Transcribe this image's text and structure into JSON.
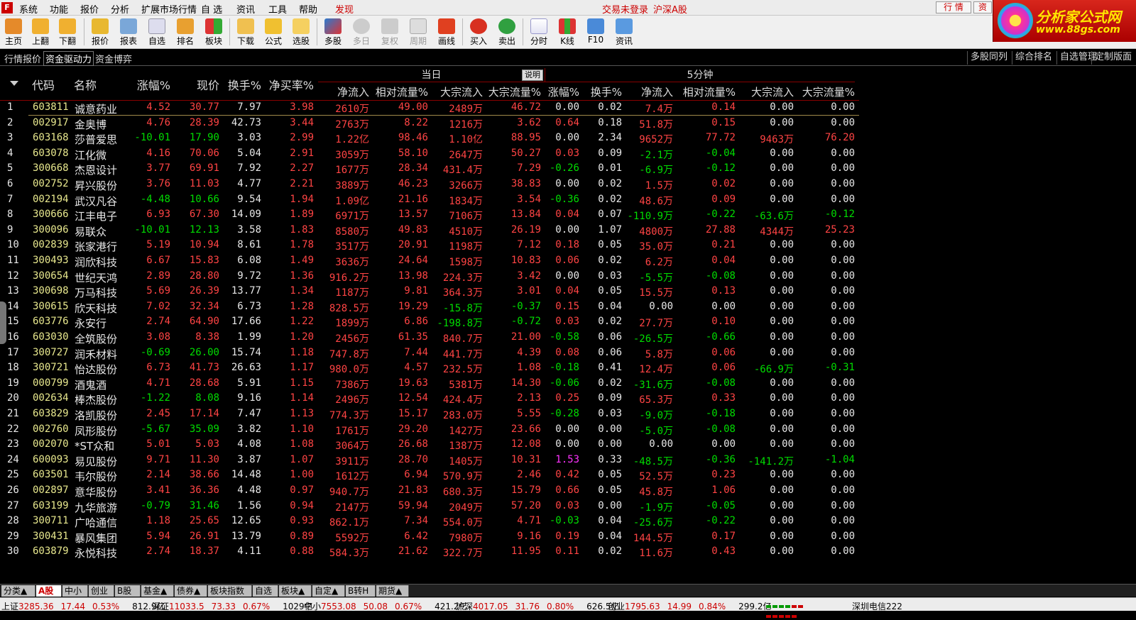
{
  "menu": {
    "items": [
      "系统",
      "功能",
      "报价",
      "分析",
      "扩展市场行情",
      "自 选",
      "资讯",
      "工具",
      "帮助",
      "发现"
    ],
    "trade_notice": "交易未登录",
    "market_notice": "沪深A股",
    "right_buttons": [
      "行 情",
      "资"
    ]
  },
  "brand": {
    "title": "分析家公式网",
    "url": "www.88gs.com"
  },
  "toolbar": {
    "buttons": [
      "主页",
      "上翻",
      "下翻",
      "报价",
      "报表",
      "自选",
      "排名",
      "板块",
      "下载",
      "公式",
      "选股",
      "多股",
      "多日",
      "复权",
      "周期",
      "画线",
      "买入",
      "卖出",
      "分时",
      "K线",
      "F10",
      "资讯"
    ]
  },
  "tabs": {
    "left": [
      "行情报价",
      "资金驱动力",
      "资金博弈"
    ],
    "right": [
      "多股同列",
      "综合排名",
      "自选管理",
      "定制版面"
    ]
  },
  "table": {
    "group_today": "当日",
    "group_today_btn": "说明",
    "group_5min": "5分钟",
    "headers": [
      "代码",
      "名称",
      "涨幅%",
      "现价",
      "换手%",
      "净买率%",
      "净流入",
      "相对流量%",
      "大宗流入",
      "大宗流量%",
      "涨幅%",
      "换手%",
      "净流入",
      "相对流量%",
      "大宗流入",
      "大宗流量%"
    ],
    "rows": [
      [
        "1",
        "603811",
        "诚意药业",
        "4.52",
        "30.77",
        "7.97",
        "3.98",
        "2610万",
        "49.00",
        "2489万",
        "46.72",
        "0.00",
        "0.02",
        "7.4万",
        "0.14",
        "0.00",
        "0.00"
      ],
      [
        "2",
        "002917",
        "金奥博",
        "4.76",
        "28.39",
        "42.73",
        "3.44",
        "2763万",
        "8.22",
        "1216万",
        "3.62",
        "0.64",
        "0.18",
        "51.8万",
        "0.15",
        "0.00",
        "0.00"
      ],
      [
        "3",
        "603168",
        "莎普爱思",
        "-10.01",
        "17.90",
        "3.03",
        "2.99",
        "1.22亿",
        "98.46",
        "1.10亿",
        "88.95",
        "0.00",
        "2.34",
        "9652万",
        "77.72",
        "9463万",
        "76.20"
      ],
      [
        "4",
        "603078",
        "江化微",
        "4.16",
        "70.06",
        "5.04",
        "2.91",
        "3059万",
        "58.10",
        "2647万",
        "50.27",
        "0.03",
        "0.09",
        "-2.1万",
        "-0.04",
        "0.00",
        "0.00"
      ],
      [
        "5",
        "300668",
        "杰恩设计",
        "3.77",
        "69.91",
        "7.92",
        "2.27",
        "1677万",
        "28.34",
        "431.4万",
        "7.29",
        "-0.26",
        "0.01",
        "-6.9万",
        "-0.12",
        "0.00",
        "0.00"
      ],
      [
        "6",
        "002752",
        "昇兴股份",
        "3.76",
        "11.03",
        "4.77",
        "2.21",
        "3889万",
        "46.23",
        "3266万",
        "38.83",
        "0.00",
        "0.02",
        "1.5万",
        "0.02",
        "0.00",
        "0.00"
      ],
      [
        "7",
        "002194",
        "武汉凡谷",
        "-4.48",
        "10.66",
        "9.54",
        "1.94",
        "1.09亿",
        "21.16",
        "1834万",
        "3.54",
        "-0.36",
        "0.02",
        "48.6万",
        "0.09",
        "0.00",
        "0.00"
      ],
      [
        "8",
        "300666",
        "江丰电子",
        "6.93",
        "67.30",
        "14.09",
        "1.89",
        "6971万",
        "13.57",
        "7106万",
        "13.84",
        "0.04",
        "0.07",
        "-110.9万",
        "-0.22",
        "-63.6万",
        "-0.12"
      ],
      [
        "9",
        "300096",
        "易联众",
        "-10.01",
        "12.13",
        "3.58",
        "1.83",
        "8580万",
        "49.83",
        "4510万",
        "26.19",
        "0.00",
        "1.07",
        "4800万",
        "27.88",
        "4344万",
        "25.23"
      ],
      [
        "10",
        "002839",
        "张家港行",
        "5.19",
        "10.94",
        "8.61",
        "1.78",
        "3517万",
        "20.91",
        "1198万",
        "7.12",
        "0.18",
        "0.05",
        "35.0万",
        "0.21",
        "0.00",
        "0.00"
      ],
      [
        "11",
        "300493",
        "润欣科技",
        "6.67",
        "15.83",
        "6.08",
        "1.49",
        "3636万",
        "24.64",
        "1598万",
        "10.83",
        "0.06",
        "0.02",
        "6.2万",
        "0.04",
        "0.00",
        "0.00"
      ],
      [
        "12",
        "300654",
        "世纪天鸿",
        "2.89",
        "28.80",
        "9.72",
        "1.36",
        "916.2万",
        "13.98",
        "224.3万",
        "3.42",
        "0.00",
        "0.03",
        "-5.5万",
        "-0.08",
        "0.00",
        "0.00"
      ],
      [
        "13",
        "300698",
        "万马科技",
        "5.69",
        "26.39",
        "13.77",
        "1.34",
        "1187万",
        "9.81",
        "364.3万",
        "3.01",
        "0.04",
        "0.05",
        "15.5万",
        "0.13",
        "0.00",
        "0.00"
      ],
      [
        "14",
        "300615",
        "欣天科技",
        "7.02",
        "32.34",
        "6.73",
        "1.28",
        "828.5万",
        "19.29",
        "-15.8万",
        "-0.37",
        "0.15",
        "0.04",
        "0.00",
        "0.00",
        "0.00",
        "0.00"
      ],
      [
        "15",
        "603776",
        "永安行",
        "2.74",
        "64.90",
        "17.66",
        "1.22",
        "1899万",
        "6.86",
        "-198.8万",
        "-0.72",
        "0.03",
        "0.02",
        "27.7万",
        "0.10",
        "0.00",
        "0.00"
      ],
      [
        "16",
        "603030",
        "全筑股份",
        "3.08",
        "8.38",
        "1.99",
        "1.20",
        "2456万",
        "61.35",
        "840.7万",
        "21.00",
        "-0.58",
        "0.06",
        "-26.5万",
        "-0.66",
        "0.00",
        "0.00"
      ],
      [
        "17",
        "300727",
        "润禾材料",
        "-0.69",
        "26.00",
        "15.74",
        "1.18",
        "747.8万",
        "7.44",
        "441.7万",
        "4.39",
        "0.08",
        "0.06",
        "5.8万",
        "0.06",
        "0.00",
        "0.00"
      ],
      [
        "18",
        "300721",
        "怡达股份",
        "6.73",
        "41.73",
        "26.63",
        "1.17",
        "980.0万",
        "4.57",
        "232.5万",
        "1.08",
        "-0.18",
        "0.41",
        "12.4万",
        "0.06",
        "-66.9万",
        "-0.31"
      ],
      [
        "19",
        "000799",
        "酒鬼酒",
        "4.71",
        "28.68",
        "5.91",
        "1.15",
        "7386万",
        "19.63",
        "5381万",
        "14.30",
        "-0.06",
        "0.02",
        "-31.6万",
        "-0.08",
        "0.00",
        "0.00"
      ],
      [
        "20",
        "002634",
        "棒杰股份",
        "-1.22",
        "8.08",
        "9.16",
        "1.14",
        "2496万",
        "12.54",
        "424.4万",
        "2.13",
        "0.25",
        "0.09",
        "65.3万",
        "0.33",
        "0.00",
        "0.00"
      ],
      [
        "21",
        "603829",
        "洛凯股份",
        "2.45",
        "17.14",
        "7.47",
        "1.13",
        "774.3万",
        "15.17",
        "283.0万",
        "5.55",
        "-0.28",
        "0.03",
        "-9.0万",
        "-0.18",
        "0.00",
        "0.00"
      ],
      [
        "22",
        "002760",
        "凤形股份",
        "-5.67",
        "35.09",
        "3.82",
        "1.10",
        "1761万",
        "29.20",
        "1427万",
        "23.66",
        "0.00",
        "0.00",
        "-5.0万",
        "-0.08",
        "0.00",
        "0.00"
      ],
      [
        "23",
        "002070",
        "*ST众和",
        "5.01",
        "5.03",
        "4.08",
        "1.08",
        "3064万",
        "26.68",
        "1387万",
        "12.08",
        "0.00",
        "0.00",
        "0.00",
        "0.00",
        "0.00",
        "0.00"
      ],
      [
        "24",
        "600093",
        "易见股份",
        "9.71",
        "11.30",
        "3.87",
        "1.07",
        "3911万",
        "28.70",
        "1405万",
        "10.31",
        "1.53",
        "0.33",
        "-48.5万",
        "-0.36",
        "-141.2万",
        "-1.04"
      ],
      [
        "25",
        "603501",
        "韦尔股份",
        "2.14",
        "38.66",
        "14.48",
        "1.00",
        "1612万",
        "6.94",
        "570.9万",
        "2.46",
        "0.42",
        "0.05",
        "52.5万",
        "0.23",
        "0.00",
        "0.00"
      ],
      [
        "26",
        "002897",
        "意华股份",
        "3.41",
        "36.36",
        "4.48",
        "0.97",
        "940.7万",
        "21.83",
        "680.3万",
        "15.79",
        "0.66",
        "0.05",
        "45.8万",
        "1.06",
        "0.00",
        "0.00"
      ],
      [
        "27",
        "603199",
        "九华旅游",
        "-0.79",
        "31.46",
        "1.56",
        "0.94",
        "2147万",
        "59.94",
        "2049万",
        "57.20",
        "0.03",
        "0.00",
        "-1.9万",
        "-0.05",
        "0.00",
        "0.00"
      ],
      [
        "28",
        "300711",
        "广哈通信",
        "1.18",
        "25.65",
        "12.65",
        "0.93",
        "862.1万",
        "7.34",
        "554.0万",
        "4.71",
        "-0.03",
        "0.04",
        "-25.6万",
        "-0.22",
        "0.00",
        "0.00"
      ],
      [
        "29",
        "300431",
        "暴风集团",
        "5.94",
        "26.91",
        "13.79",
        "0.89",
        "5592万",
        "6.42",
        "7980万",
        "9.16",
        "0.19",
        "0.04",
        "144.5万",
        "0.17",
        "0.00",
        "0.00"
      ],
      [
        "30",
        "603879",
        "永悦科技",
        "2.74",
        "18.37",
        "4.11",
        "0.88",
        "584.3万",
        "21.62",
        "322.7万",
        "11.95",
        "0.11",
        "0.02",
        "11.6万",
        "0.43",
        "0.00",
        "0.00"
      ]
    ]
  },
  "bottom_tabs": [
    "分类▲",
    "A股",
    "中小",
    "创业",
    "B股",
    "基金▲",
    "债券▲",
    "板块指数",
    "自选",
    "板块▲",
    "自定▲",
    "B转H",
    "期货▲"
  ],
  "status": [
    {
      "name": "上证",
      "price": "3285.36",
      "chg": "17.44",
      "pct": "0.53%",
      "amt": "812.9亿"
    },
    {
      "name": "深证",
      "price": "11033.5",
      "chg": "73.33",
      "pct": "0.67%",
      "amt": "1029亿"
    },
    {
      "name": "中小",
      "price": "7553.08",
      "chg": "50.08",
      "pct": "0.67%",
      "amt": "421.2亿"
    },
    {
      "name": "沪深",
      "price": "4017.05",
      "chg": "31.76",
      "pct": "0.80%",
      "amt": "626.5亿"
    },
    {
      "name": "创业",
      "price": "1795.63",
      "chg": "14.99",
      "pct": "0.84%",
      "amt": "299.2亿"
    }
  ],
  "server": "深圳电信222"
}
